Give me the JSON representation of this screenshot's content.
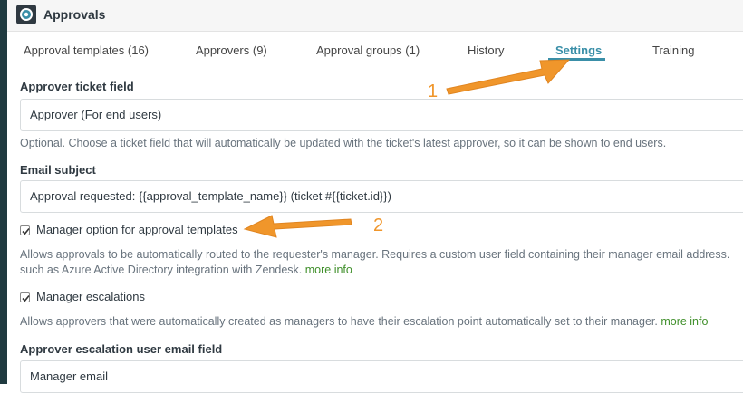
{
  "window": {
    "title": "Approvals",
    "app_icon": "zendesk-approvals-icon"
  },
  "tabs": [
    {
      "label": "Approval templates (16)",
      "active": false
    },
    {
      "label": "Approvers (9)",
      "active": false
    },
    {
      "label": "Approval groups (1)",
      "active": false
    },
    {
      "label": "History",
      "active": false
    },
    {
      "label": "Settings",
      "active": true
    },
    {
      "label": "Training",
      "active": false
    }
  ],
  "settings": {
    "approver_ticket_field": {
      "label": "Approver ticket field",
      "value": "Approver (For end users)",
      "help": "Optional. Choose a ticket field that will automatically be updated with the ticket's latest approver, so it can be shown to end users."
    },
    "email_subject": {
      "label": "Email subject",
      "value": "Approval requested: {{approval_template_name}} (ticket #{{ticket.id}})"
    },
    "manager_option": {
      "label": "Manager option for approval templates",
      "checked": true,
      "help_line1": "Allows approvals to be automatically routed to the requester's manager. Requires a custom user field containing their manager email address.",
      "help_line2": "such as Azure Active Directory integration with Zendesk.",
      "link": "more info"
    },
    "manager_escalations": {
      "label": "Manager escalations",
      "checked": true,
      "help": "Allows approvers that were automatically created as managers to have their escalation point automatically set to their manager.",
      "link": "more info"
    },
    "escalation_email_field": {
      "label": "Approver escalation user email field",
      "value": "Manager email"
    }
  },
  "annotations": [
    {
      "number": "1",
      "color": "#f0962b"
    },
    {
      "number": "2",
      "color": "#f0962b"
    }
  ]
}
